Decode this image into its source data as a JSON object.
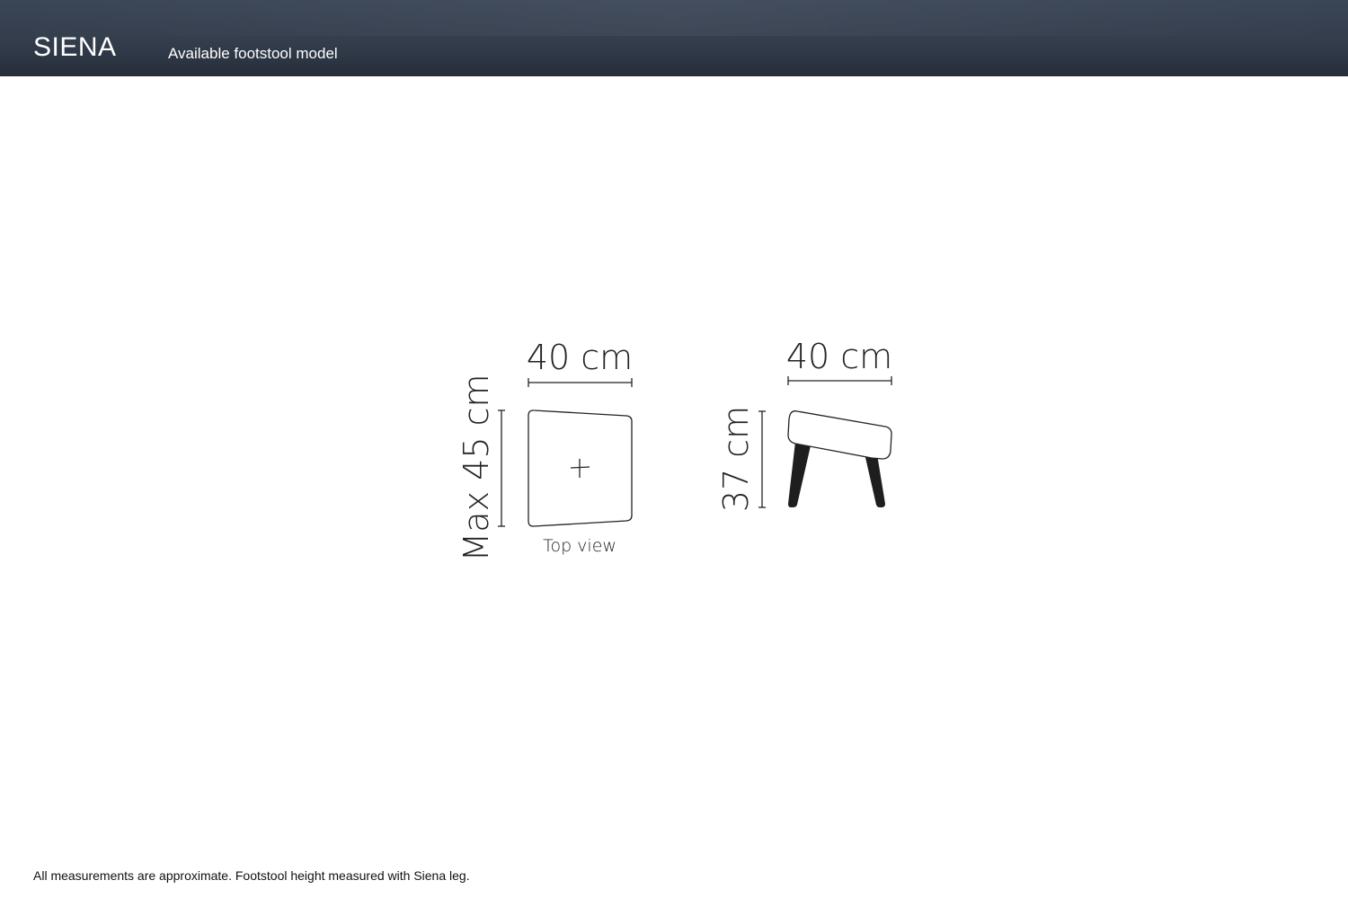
{
  "header": {
    "title": "SIENA",
    "subtitle": "Available footstool model"
  },
  "top_view": {
    "width_label": "40 cm",
    "depth_label": "Max 45 cm",
    "caption": "Top view"
  },
  "side_view": {
    "width_label": "40 cm",
    "height_label": "37 cm"
  },
  "footer": {
    "note": "All measurements are approximate. Footstool height measured with Siena leg."
  },
  "colors": {
    "header_bg": "#333d4c",
    "line": "#222222",
    "leg": "#1e1e1e"
  }
}
